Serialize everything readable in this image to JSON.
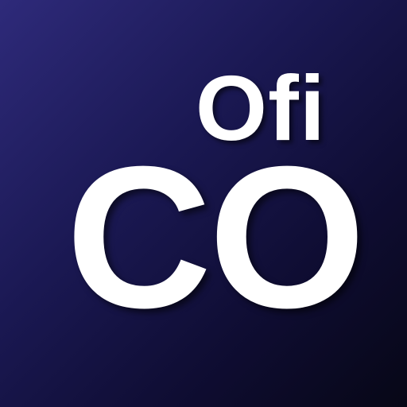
{
  "logo": {
    "line1": "Ofi",
    "line2": "CO",
    "text_color": "#ffffff",
    "background_gradient": [
      "#2e2a7a",
      "#1a1852",
      "#0f0d33",
      "#070716"
    ]
  }
}
